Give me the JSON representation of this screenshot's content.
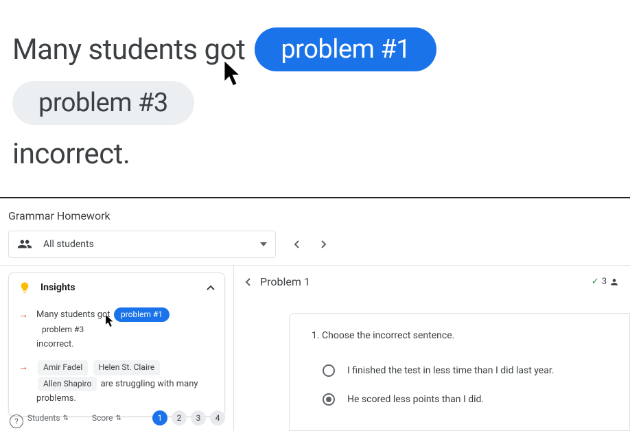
{
  "hero": {
    "text_before": "Many students got",
    "chip_active": "problem #1",
    "chip_inactive": "problem #3",
    "text_after": "incorrect."
  },
  "app": {
    "title": "Grammar Homework",
    "dropdown_label": "All students"
  },
  "insights": {
    "title": "Insights",
    "item1_before": "Many students got",
    "item1_chip": "problem #1",
    "item1_plain": "problem #3",
    "item1_after": "incorrect.",
    "item2_name1": "Amir Fadel",
    "item2_name2": "Helen St. Claire",
    "item2_name3": "Allen Shapiro",
    "item2_after": "are struggling with many problems."
  },
  "columns": {
    "students": "Students",
    "score": "Score"
  },
  "pages": [
    "1",
    "2",
    "3",
    "4"
  ],
  "problem": {
    "title": "Problem 1",
    "count": "3",
    "question": "1.  Choose the incorrect sentence.",
    "options": [
      "I finished the test in less time than I did last year.",
      "He scored less points than I did."
    ]
  }
}
